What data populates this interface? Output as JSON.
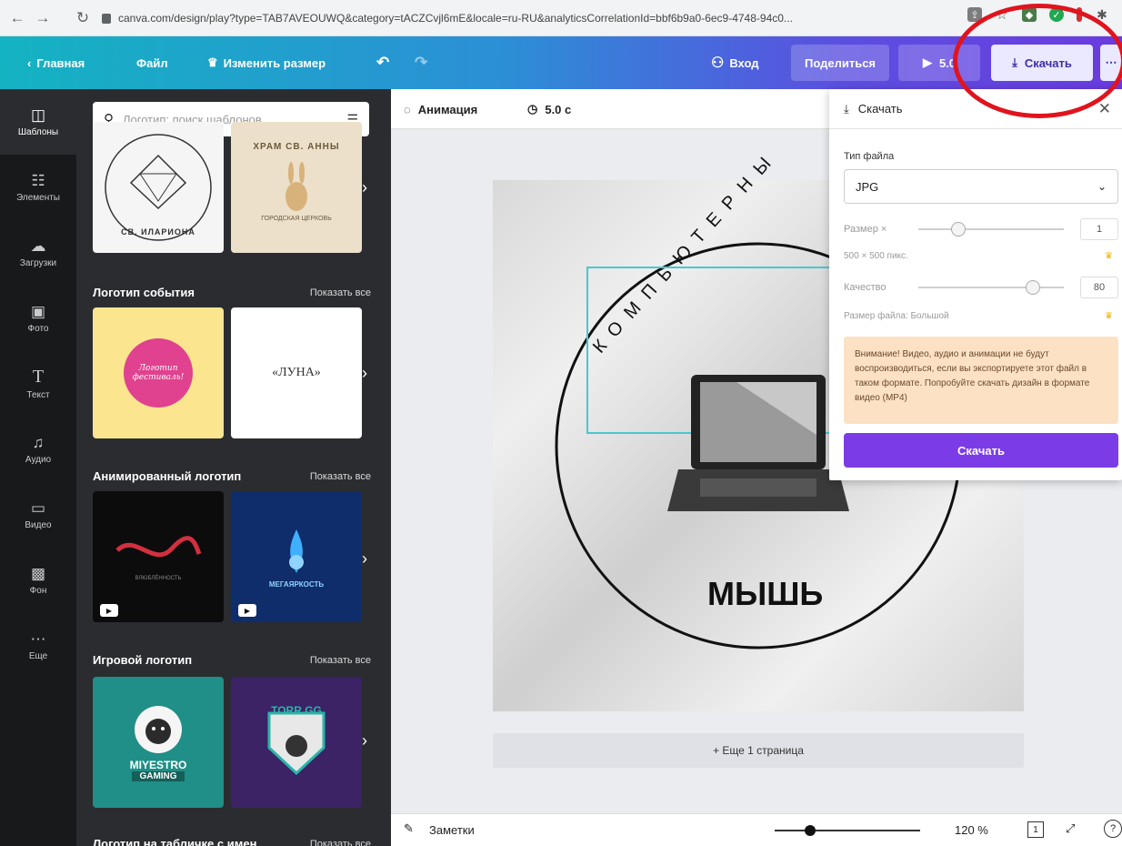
{
  "browser": {
    "url": "canva.com/design/play?type=TAB7AVEOUWQ&category=tACZCvjl6mE&locale=ru-RU&analyticsCorrelationId=bbf6b9a0-6ec9-4748-94c0..."
  },
  "topbar": {
    "home": "Главная",
    "file": "Файл",
    "resize": "Изменить размер",
    "login": "Вход",
    "share": "Поделиться",
    "play": "5.0",
    "download": "Скачать"
  },
  "rail": [
    {
      "icon": "templates-icon",
      "label": "Шаблоны"
    },
    {
      "icon": "elements-icon",
      "label": "Элементы"
    },
    {
      "icon": "uploads-icon",
      "label": "Загрузки"
    },
    {
      "icon": "photos-icon",
      "label": "Фото"
    },
    {
      "icon": "text-icon",
      "label": "Текст"
    },
    {
      "icon": "audio-icon",
      "label": "Аудио"
    },
    {
      "icon": "video-icon",
      "label": "Видео"
    },
    {
      "icon": "background-icon",
      "label": "Фон"
    },
    {
      "icon": "more-icon",
      "label": "Еще"
    }
  ],
  "panel": {
    "search_placeholder": "Логотип: поиск шаблонов",
    "sections": [
      {
        "title": "Логотип события",
        "show_all": "Показать все"
      },
      {
        "title": "Анимированный логотип",
        "show_all": "Показать все"
      },
      {
        "title": "Игровой логотип",
        "show_all": "Показать все"
      },
      {
        "title": "Логотип на табличке с имен...",
        "show_all": "Показать все"
      }
    ],
    "thumbs": {
      "t1": "СВ. ИЛАРИОНА",
      "t2_top": "ХРАМ СВ. АННЫ",
      "t2_bottom": "ГОРОДСКАЯ ЦЕРКОВЬ",
      "t3": "Логотип фестиваль!",
      "t4": "«ЛУНА»",
      "t5": "ВЛЮБЛЁННОСТЬ",
      "t6": "МЕГАЯРКОСТЬ",
      "t7_a": "MIYESTRO",
      "t7_b": "GAMING",
      "t8": "TORR.GG"
    }
  },
  "editor": {
    "animation": "Анимация",
    "duration": "5.0 с",
    "arc_text": "КОМПЬЮТЕРНЫ",
    "bottom_text": "МЫШЬ",
    "add_page": "+ Еще 1 страница",
    "notes": "Заметки",
    "zoom": "120 %",
    "page_num": "1"
  },
  "download_panel": {
    "title": "Скачать",
    "file_type_label": "Тип файла",
    "file_type_value": "JPG",
    "size_label": "Размер ×",
    "size_value": "1",
    "size_px": "500 × 500 пикс.",
    "quality_label": "Качество",
    "quality_value": "80",
    "file_size": "Размер файла: Большой",
    "warning": "Внимание! Видео, аудио и анимации не будут воспроизводиться, если вы экспортируете этот файл в таком формате. Попробуйте скачать дизайн в формате видео (MP4)",
    "button": "Скачать"
  }
}
